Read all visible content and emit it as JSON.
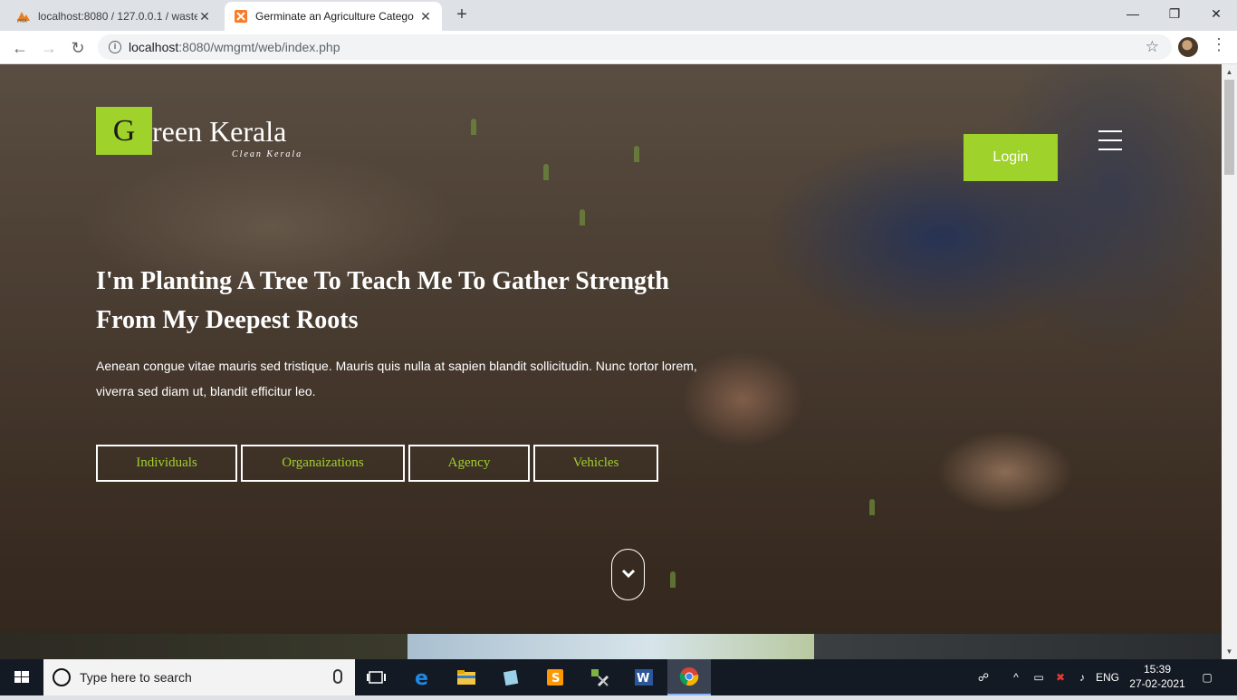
{
  "browser": {
    "tabs": [
      {
        "title": "localhost:8080 / 127.0.0.1 / waste",
        "active": false
      },
      {
        "title": "Germinate an Agriculture Catego",
        "active": true
      }
    ],
    "new_tab_label": "+",
    "url_host": "localhost",
    "url_rest": ":8080/wmgmt/web/index.php"
  },
  "site": {
    "logo_letter": "G",
    "logo_text": "reen Kerala",
    "logo_tagline": "Clean Kerala",
    "login_label": "Login",
    "headline": "I'm Planting A Tree To Teach Me To Gather Strength From My Deepest Roots",
    "lead": "Aenean congue vitae mauris sed tristique. Mauris quis nulla at sapien blandit sollicitudin. Nunc tortor lorem, viverra sed diam ut, blandit efficitur leo.",
    "categories": [
      "Individuals",
      "Organaizations",
      "Agency",
      "Vehicles"
    ],
    "accent": "#9fd22a"
  },
  "taskbar": {
    "search_placeholder": "Type here to search",
    "language": "ENG",
    "time": "15:39",
    "date": "27-02-2021"
  }
}
